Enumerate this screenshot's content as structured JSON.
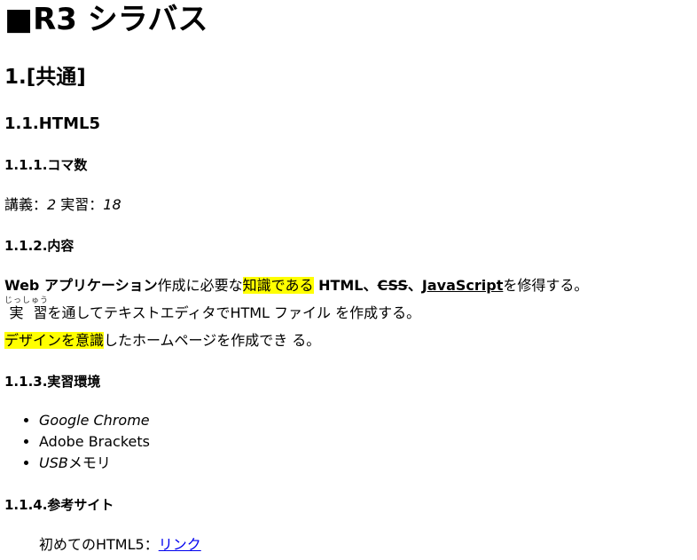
{
  "page_title": "■R3 シラバス",
  "section1": {
    "title": "1.[共通]"
  },
  "section1_1": {
    "title": "1.1.HTML5"
  },
  "koma": {
    "title": "1.1.1.コマ数",
    "lecture_label": "講義：",
    "lecture_value": "2",
    "practice_label": " 実習：",
    "practice_value": "18"
  },
  "content": {
    "title": "1.1.2.内容",
    "line1_part1": "Web アプリケーション",
    "line1_part2": "作成に必要な",
    "line1_highlight": "知識である",
    "line1_html": " HTML、",
    "line1_css": "CSS",
    "line1_sep": "、",
    "line1_js": "JavaScript",
    "line1_end": "を修得する。",
    "line2_ruby_base": "実 習",
    "line2_ruby_text": "じっしゅう",
    "line2_rest": "を通してテキストエディタでHTML ファイル を作成する。",
    "line3_highlight": "デザインを意識",
    "line3_rest": "したホームページを作成でき る。"
  },
  "environment": {
    "title": "1.1.3.実習環境",
    "items": [
      {
        "text": "Google Chrome",
        "style": "italic"
      },
      {
        "text": "Adobe Brackets",
        "style": "normal"
      },
      {
        "text_italic": "USB",
        "text_rest": "メモリ"
      }
    ]
  },
  "reference": {
    "title": "1.1.4.参考サイト",
    "label": "初めてのHTML5：",
    "link_text": "リンク"
  }
}
